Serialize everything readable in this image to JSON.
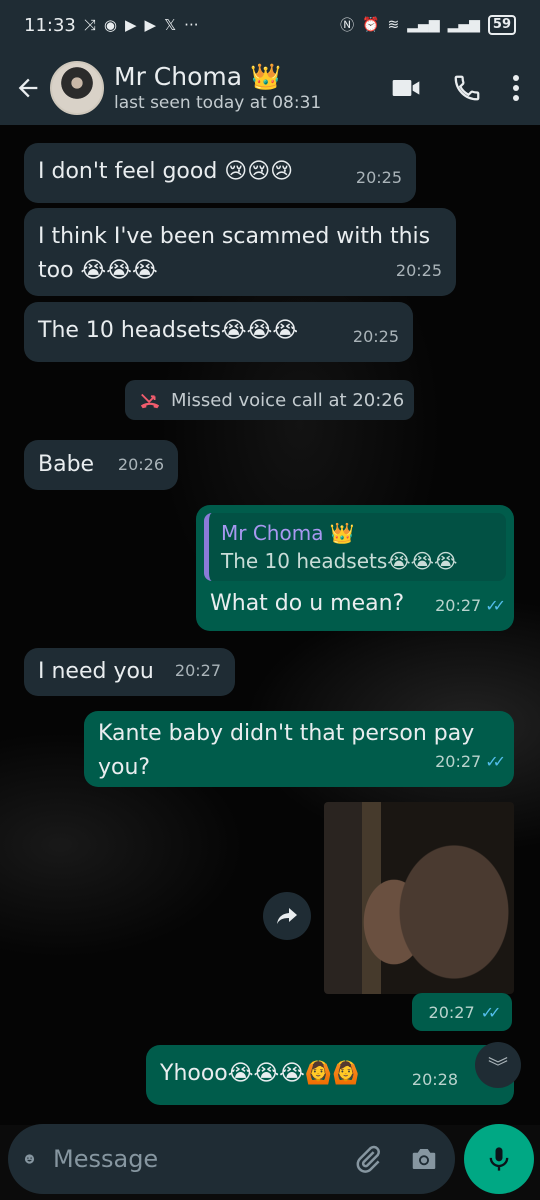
{
  "status_bar": {
    "time": "11:33",
    "battery": "59"
  },
  "header": {
    "contact_name": "Mr Choma 👑",
    "last_seen": "last seen today at 08:31"
  },
  "messages": [
    {
      "direction": "in",
      "text": "I don't feel good 😢😢😢",
      "time": "20:25"
    },
    {
      "direction": "in",
      "text": "I think I've been scammed with this too 😭😭😭",
      "time": "20:25"
    },
    {
      "direction": "in",
      "text": "The 10 headsets😭😭😭",
      "time": "20:25"
    },
    {
      "direction": "in",
      "text": "Babe",
      "time": "20:26"
    },
    {
      "direction": "out",
      "reply_name": "Mr Choma 👑",
      "reply_text": "The 10 headsets😭😭😭",
      "text": "What do u mean?",
      "time": "20:27"
    },
    {
      "direction": "in",
      "text": "I need you",
      "time": "20:27"
    },
    {
      "direction": "out",
      "text": "Kante baby didn't that person pay you?",
      "time": "20:27"
    },
    {
      "direction": "out",
      "type": "image",
      "time": "20:27"
    },
    {
      "direction": "out",
      "text": "Yhooo😭😭😭🙆🙆",
      "time": "20:28"
    }
  ],
  "system": {
    "missed_call": "Missed voice call at 20:26"
  },
  "input": {
    "placeholder": "Message"
  },
  "colors": {
    "header_bg": "#1f2c34",
    "incoming_bubble": "#1f2c34",
    "outgoing_bubble": "#005c4b",
    "accent": "#00a884",
    "read_ticks": "#53bdeb"
  }
}
